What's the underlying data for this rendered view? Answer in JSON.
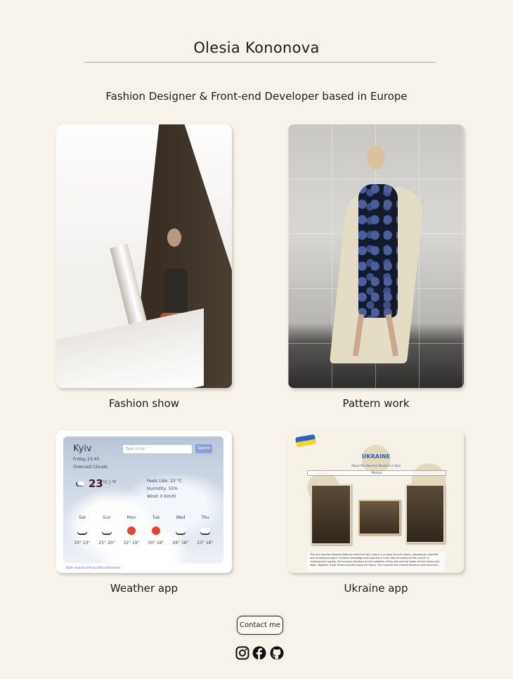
{
  "header": {
    "title": "Olesia Kononova",
    "tagline": "Fashion Designer & Front-end Developer based in Europe"
  },
  "projects": [
    {
      "caption": "Fashion show"
    },
    {
      "caption": "Pattern work"
    },
    {
      "caption": "Weather app"
    },
    {
      "caption": "Ukraine app"
    }
  ],
  "weather_screenshot": {
    "city": "Kyiv",
    "search_placeholder": "Type a city...",
    "search_button": "Search",
    "date": "Friday 23:45",
    "description": "Overcast Clouds",
    "temperature": "23",
    "units": "°C | °F",
    "feels_like": "Feels Like: 23 °C",
    "humidity": "Humidity: 55%",
    "wind": "Wind: 0 Km/H",
    "days": [
      "Sat",
      "Sun",
      "Mon",
      "Tue",
      "Wed",
      "Thu"
    ],
    "ranges": [
      "33° 23°",
      "25° 20°",
      "32° 19°",
      "30° 18°",
      "26° 18°",
      "23° 18°"
    ],
    "source_link": "Open source code by Olesia Kononova"
  },
  "ukraine_screenshot": {
    "title": "UKRAINE",
    "subtitle": "About the Honchar Museum in Kyiv",
    "tab": "Mission",
    "body": "The Ivan Honchar Museum National Centre of Folk Culture is an open art and culture, educational, scientific and recreational space. It fosters knowledge and experience in the field of traditional folk culture. In contemporary society, the museum functions as the custodian of the past and the leader of new visions and ideas. Together, these factors actively shape the future. The museum was created based on Ivan Honchar's"
  },
  "footer": {
    "contact_label": "Contact me"
  },
  "icons": [
    "instagram-icon",
    "facebook-icon",
    "github-icon"
  ]
}
